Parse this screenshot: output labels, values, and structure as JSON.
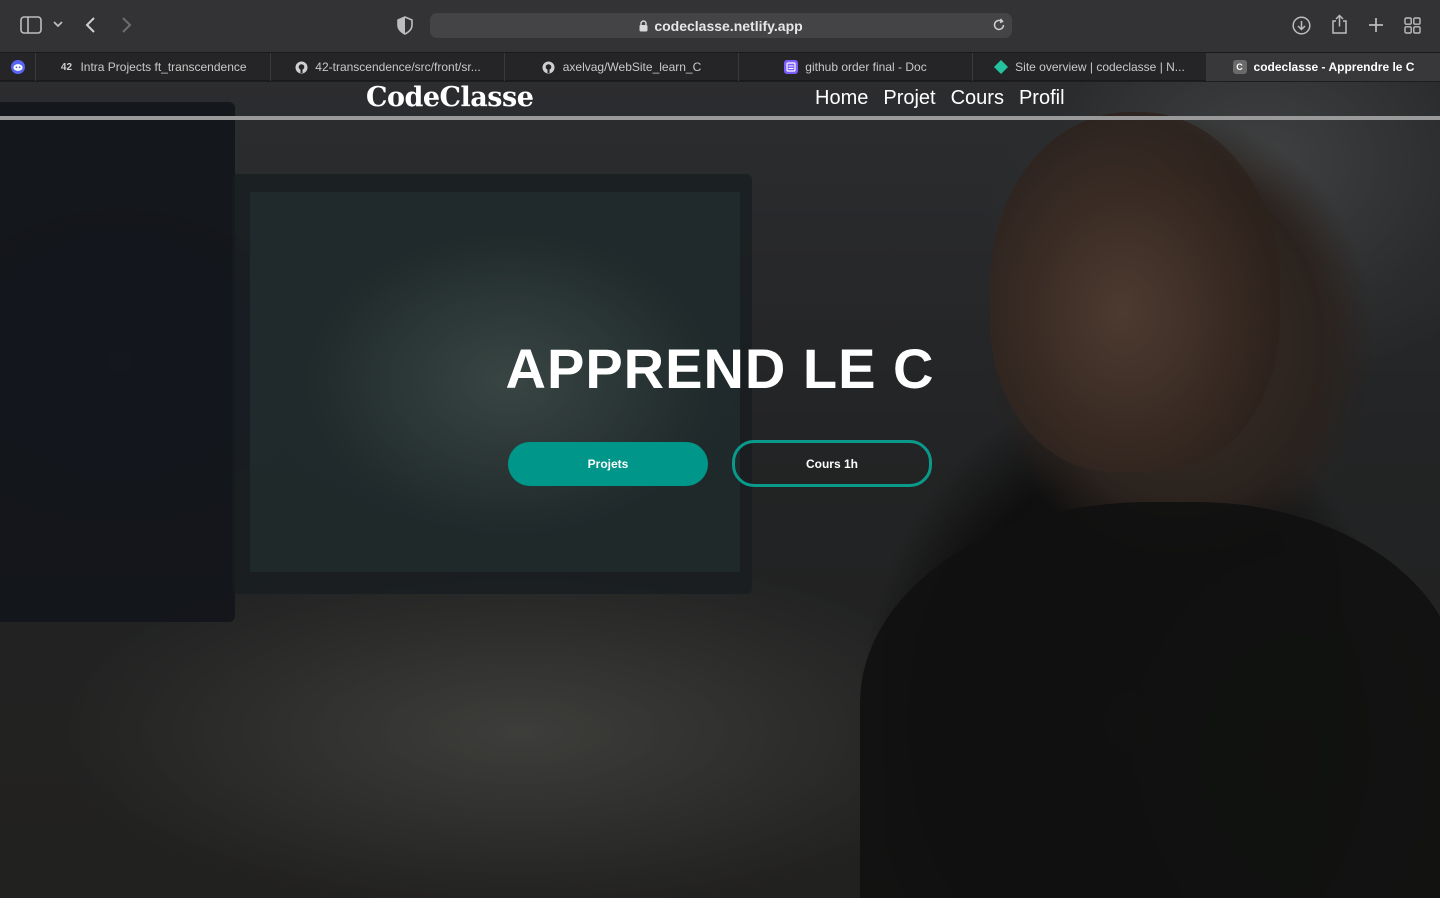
{
  "browser": {
    "url": "codeclasse.netlify.app",
    "tabs": [
      {
        "title": "",
        "favicon": "discord-icon",
        "color": "#5865f2"
      },
      {
        "title": "Intra Projects ft_transcendence",
        "favicon": "42-icon",
        "color": "#d0d0d0"
      },
      {
        "title": "42-transcendence/src/front/sr...",
        "favicon": "github-icon",
        "color": "#d0d0d0"
      },
      {
        "title": "axelvag/WebSite_learn_C",
        "favicon": "github-icon",
        "color": "#d0d0d0"
      },
      {
        "title": "github order final - Doc",
        "favicon": "doc-icon",
        "color": "#7b5cff"
      },
      {
        "title": "Site overview | codeclasse | N...",
        "favicon": "netlify-icon",
        "color": "#25c2a0"
      },
      {
        "title": "codeclasse - Apprendre le C",
        "favicon": "codeclasse-favicon",
        "color": "#6a6a6a",
        "letter": "C"
      }
    ]
  },
  "site": {
    "logo": "CodeClasse",
    "nav": [
      "Home",
      "Projet",
      "Cours",
      "Profil"
    ],
    "hero_title": "APPREND LE C",
    "primary_button": "Projets",
    "secondary_button": "Cours 1h",
    "accent_color": "#00968a"
  }
}
